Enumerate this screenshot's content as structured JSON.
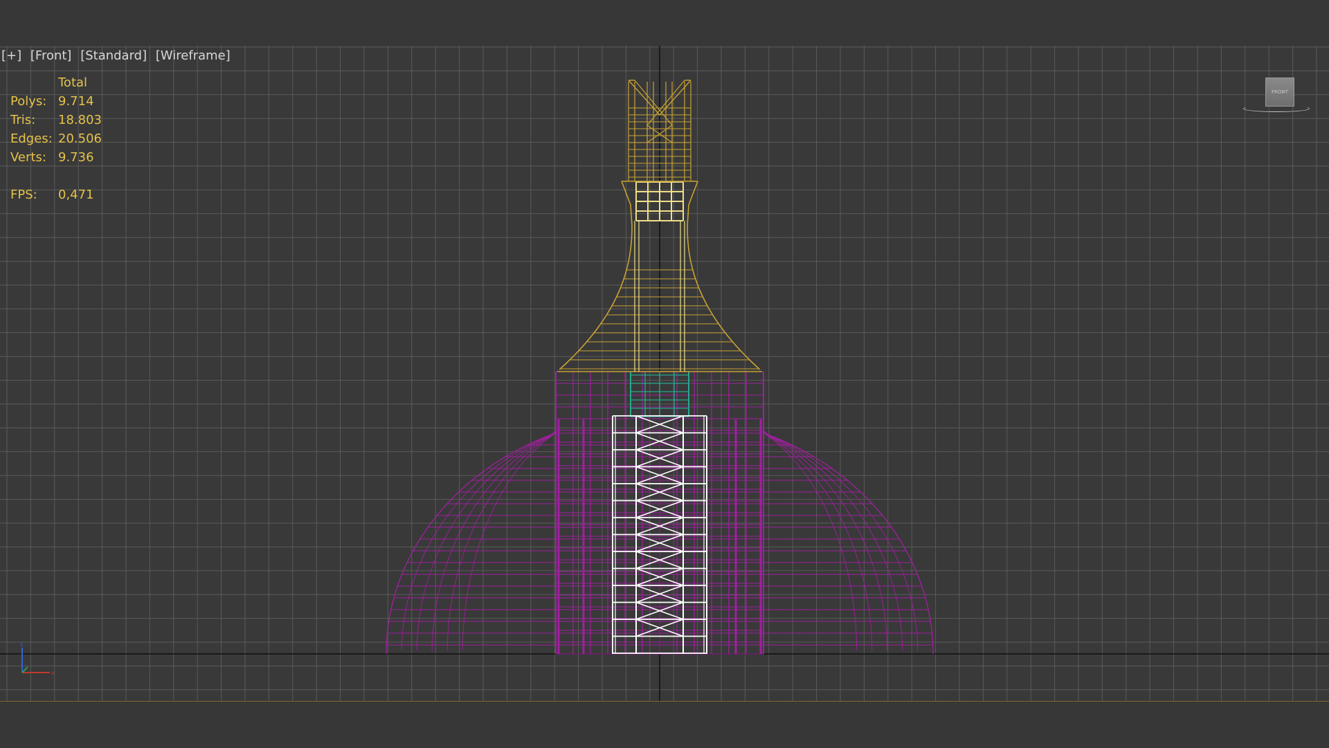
{
  "viewport": {
    "labels": [
      "[+]",
      "[Front]",
      "[Standard]",
      "[Wireframe]"
    ],
    "stats": {
      "header": "Total",
      "rows": [
        {
          "key": "Polys:",
          "value": "9.714"
        },
        {
          "key": "Tris:",
          "value": "18.803"
        },
        {
          "key": "Edges:",
          "value": "20.506"
        },
        {
          "key": "Verts:",
          "value": "9.736"
        }
      ],
      "fps_key": "FPS:",
      "fps_value": "0,471"
    },
    "viewcube_face": "FRONT",
    "icons": {
      "viewcube": "viewcube-icon",
      "axis_tripod": "axis-tripod-icon"
    }
  },
  "colors": {
    "background": "#393939",
    "grid": "#5b5b5b",
    "stats_text": "#e6c24a",
    "spire": "#c9a334",
    "spire_highlight": "#f0e08a",
    "band": "#27a88f",
    "dome": "#a0209f",
    "core": "#ffffff"
  }
}
